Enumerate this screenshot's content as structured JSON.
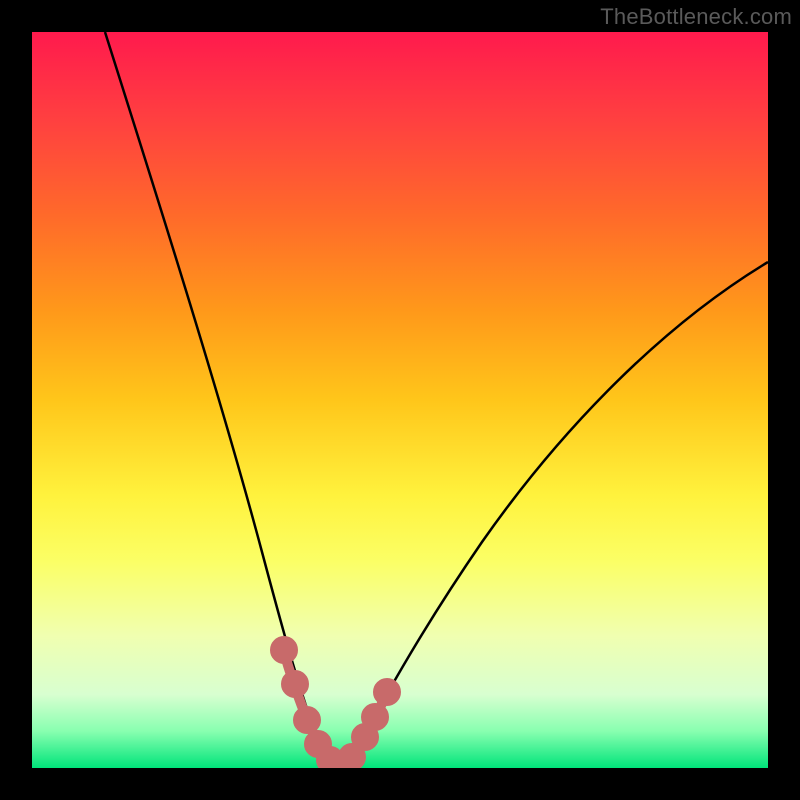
{
  "watermark": "TheBottleneck.com",
  "colors": {
    "frame": "#000000",
    "curve_stroke": "#000000",
    "accent_stroke": "#cc6666",
    "accent_fill": "#d77b7b"
  },
  "chart_data": {
    "type": "line",
    "title": "",
    "xlabel": "",
    "ylabel": "",
    "xlim": [
      0,
      100
    ],
    "ylim": [
      0,
      100
    ],
    "x": [
      10,
      15,
      20,
      25,
      28,
      30,
      32,
      34,
      35,
      36,
      37,
      38,
      39,
      40,
      41,
      42,
      43,
      44,
      46,
      48,
      50,
      55,
      60,
      65,
      70,
      80,
      90,
      100
    ],
    "y": [
      100,
      88,
      75,
      60,
      48,
      40,
      30,
      20,
      15,
      10,
      6,
      4,
      2,
      1,
      0.5,
      0.5,
      1,
      2,
      5,
      9,
      14,
      25,
      34,
      42,
      49,
      60,
      69,
      75
    ],
    "accent_points_x": [
      34,
      36,
      37.5,
      39,
      40,
      41,
      42,
      43,
      45,
      46,
      47.5
    ],
    "accent_points_y": [
      20,
      10,
      5,
      2,
      1,
      0.5,
      0.5,
      1,
      4,
      6,
      10
    ]
  }
}
